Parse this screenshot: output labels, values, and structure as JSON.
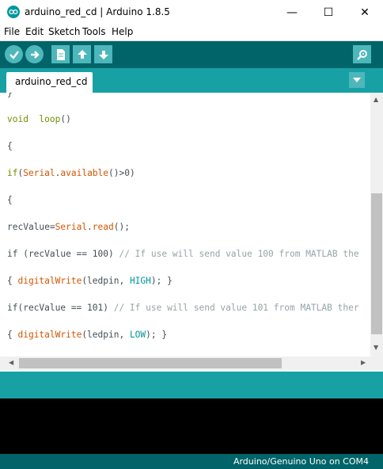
{
  "window": {
    "title": "arduino_red_cd | Arduino 1.8.5",
    "minimize_symbol": "—",
    "maximize_symbol": "☐",
    "close_symbol": "✕"
  },
  "menu": [
    "File",
    "Edit",
    "Sketch",
    "Tools",
    "Help"
  ],
  "toolbar": {
    "buttons": [
      "verify-icon",
      "upload-icon",
      "new-icon",
      "open-icon",
      "save-icon",
      "serial-monitor-icon"
    ]
  },
  "tabs": [
    {
      "label": "arduino_red_cd",
      "active": true
    }
  ],
  "editor": {
    "lines": [
      [
        "void ",
        " loop",
        "()"
      ],
      [
        "{"
      ],
      [
        "if",
        "(",
        "Serial",
        ".",
        "available",
        "()>0)"
      ],
      [
        "{"
      ],
      [
        "recValue=",
        "Serial",
        ".",
        "read",
        "();"
      ],
      [
        "if (recValue == 100) ",
        "// If use will send value 100 from MATLAB the"
      ],
      [
        "{ ",
        "digitalWrite",
        "(ledpin, ",
        "HIGH",
        "); }"
      ],
      [
        "if(recValue == 101) ",
        "// If use will send value 101 from MATLAB ther"
      ],
      [
        "{ ",
        "digitalWrite",
        "(ledpin, ",
        "LOW",
        "); }"
      ]
    ]
  },
  "status": {
    "board": "Arduino/Genuino Uno on COM4"
  },
  "colors": {
    "toolbar": "#006468",
    "tabbar": "#17a1a5",
    "button": "#4db7bb",
    "keyword": "#728e00",
    "function": "#d35400",
    "comment": "#95a5a6",
    "constant": "#00979c"
  }
}
